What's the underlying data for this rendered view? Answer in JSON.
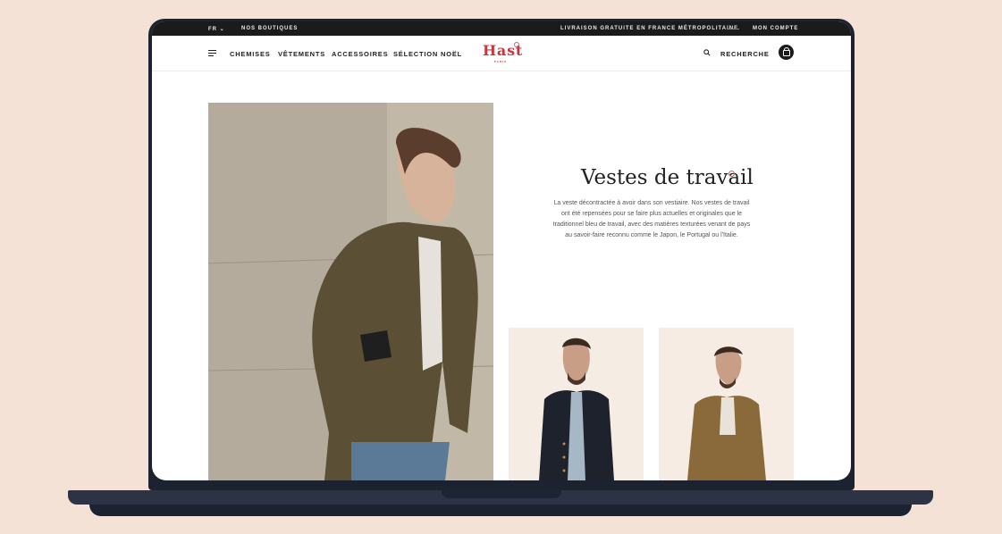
{
  "topbar": {
    "language": "FR",
    "stores": "NOS BOUTIQUES",
    "shipping": "LIVRAISON GRATUITE EN FRANCE MÉTROPOLITAINE",
    "account": "MON COMPTE"
  },
  "nav": {
    "items": [
      "CHEMISES",
      "VÊTEMENTS",
      "ACCESSOIRES",
      "SÉLECTION NOËL"
    ],
    "search_label": "RECHERCHE"
  },
  "logo": {
    "name": "Hast",
    "sub": "PARIS"
  },
  "main": {
    "title": "Vestes de travail",
    "description": "La veste décontractée à avoir dans son vestiaire. Nos vestes de travail ont été repensées pour se faire plus actuelles et originales que le traditionnel bleu de travail, avec des matières texturées venant de pays au savoir-faire reconnu comme le Japon, le Portugal ou l'Italie."
  },
  "colors": {
    "brand_red": "#c9363e",
    "topbar": "#1b1b1b",
    "background": "#f3e2d5"
  }
}
